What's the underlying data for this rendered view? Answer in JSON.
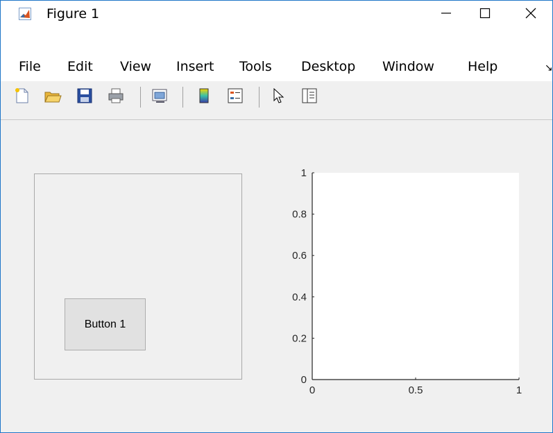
{
  "window": {
    "title": "Figure 1"
  },
  "menu": {
    "items": [
      "File",
      "Edit",
      "View",
      "Insert",
      "Tools",
      "Desktop",
      "Window",
      "Help"
    ],
    "overflow": "↘"
  },
  "toolbar": {
    "icons": [
      "new-figure-icon",
      "open-file-icon",
      "save-icon",
      "print-icon",
      "link-plot-icon",
      "colorbar-icon",
      "legend-icon",
      "pointer-icon",
      "property-inspector-icon"
    ]
  },
  "panel": {
    "button_label": "Button 1"
  },
  "chart_data": {
    "type": "line",
    "series": [],
    "xlim": [
      0,
      1
    ],
    "ylim": [
      0,
      1
    ],
    "xticks": [
      "0",
      "0.5",
      "1"
    ],
    "yticks": [
      "0",
      "0.2",
      "0.4",
      "0.6",
      "0.8",
      "1"
    ],
    "grid": false
  }
}
